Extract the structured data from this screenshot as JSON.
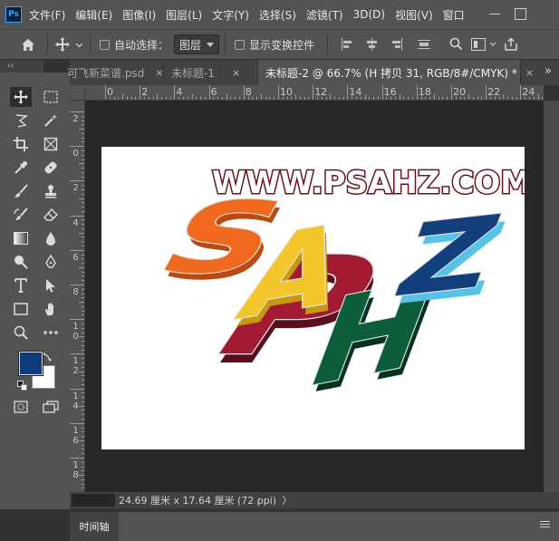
{
  "menubar": {
    "logo": "Ps",
    "items": [
      "文件(F)",
      "编辑(E)",
      "图像(I)",
      "图层(L)",
      "文字(Y)",
      "选择(S)",
      "滤镜(T)",
      "3D(D)",
      "视图(V)",
      "窗口"
    ]
  },
  "options": {
    "auto_select_label": "自动选择：",
    "layer_select_value": "图层",
    "show_transform_label": "显示变换控件"
  },
  "tools_header": "‹‹",
  "tabs": [
    {
      "label": "可飞新菜谱.psd",
      "close": "×"
    },
    {
      "label": "未标题-1",
      "close": "×"
    },
    {
      "label": "未标题-2 @ 66.7% (H 拷贝 31, RGB/8#/CMYK) *",
      "close": "×"
    }
  ],
  "tabs_more": "»",
  "ruler": {
    "h_labels": [
      "0",
      "2",
      "4",
      "6",
      "8",
      "10",
      "12",
      "14",
      "16",
      "18",
      "20",
      "22",
      "24"
    ],
    "v_labels": [
      "2",
      "0",
      "2",
      "4",
      "6",
      "8",
      "10",
      "12",
      "14",
      "16",
      "18"
    ]
  },
  "artwork": {
    "url_text": "WWW.PSAHZ.COM",
    "letters": [
      "S",
      "A",
      "H",
      "Z",
      "P"
    ],
    "colors": {
      "S_face": "#ef6a1e",
      "A_face": "#f3c72b",
      "H_face": "#0c5e3b",
      "Z_face": "#133f7c",
      "P_face": "#9f1931",
      "url_fill": "#ffffff",
      "url_stroke": "#6a1217"
    }
  },
  "colors": {
    "foreground": "#0f3c7a",
    "background": "#ffffff"
  },
  "status": {
    "doc_size": "24.69 厘米 x 17.64 厘米 (72 ppi)",
    "arrow": "〉"
  },
  "timeline": {
    "title": "时间轴"
  }
}
